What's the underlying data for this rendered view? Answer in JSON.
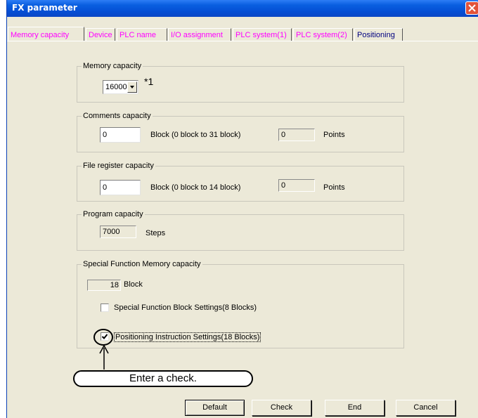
{
  "window": {
    "title": "FX parameter"
  },
  "tabs": [
    {
      "label": "Memory capacity"
    },
    {
      "label": "Device"
    },
    {
      "label": "PLC name"
    },
    {
      "label": "I/O assignment"
    },
    {
      "label": "PLC system(1)"
    },
    {
      "label": "PLC system(2)"
    },
    {
      "label": "Positioning"
    }
  ],
  "memory": {
    "label": "Memory capacity",
    "value": "16000",
    "note": "*1"
  },
  "comments": {
    "label": "Comments capacity",
    "value": "0",
    "range": "Block (0 block to 31 block)",
    "points_value": "0",
    "points_unit": "Points"
  },
  "file_register": {
    "label": "File register capacity",
    "value": "0",
    "range": "Block (0 block to 14 block)",
    "points_value": "0",
    "points_unit": "Points"
  },
  "program": {
    "label": "Program capacity",
    "value": "7000",
    "unit": "Steps"
  },
  "special": {
    "label": "Special Function Memory capacity",
    "value": "18",
    "unit": "Block",
    "sfb_label": "Special Function Block Settings(8 Blocks)",
    "sfb_checked": false,
    "pos_label": "Positioning Instruction Settings(18 Blocks)",
    "pos_checked": true
  },
  "callout": {
    "text": "Enter a check."
  },
  "buttons": {
    "default": "Default",
    "check": "Check",
    "end": "End",
    "cancel": "Cancel"
  },
  "colors": {
    "tab_text": "#ff00ff",
    "title_bar": "#0a5fe0"
  }
}
